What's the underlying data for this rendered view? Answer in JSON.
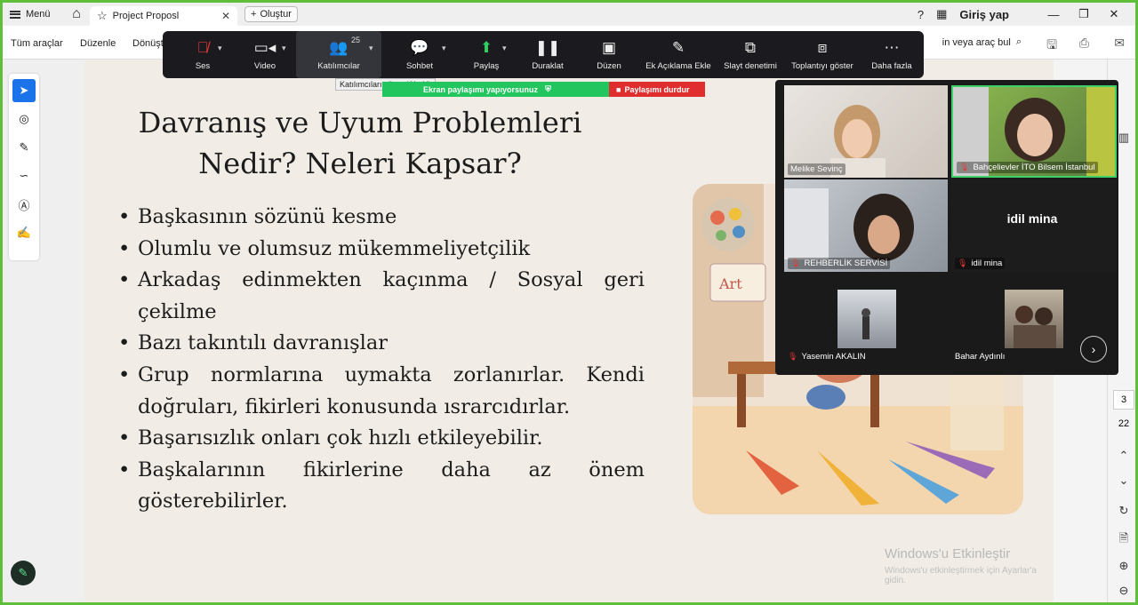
{
  "titlebar": {
    "menu_label": "Menü",
    "tab_title": "Project Proposl",
    "new_label": "Oluştur",
    "login_label": "Giriş yap"
  },
  "toolbar": {
    "items": [
      "Tüm araçlar",
      "Düzenle",
      "Dönüşt"
    ],
    "search_placeholder": "in veya araç bul"
  },
  "zoom_toolbar": {
    "buttons": [
      {
        "label": "Ses",
        "icon": "microphone-muted-icon"
      },
      {
        "label": "Video",
        "icon": "video-camera-icon"
      },
      {
        "label": "Katılımcılar",
        "icon": "participants-icon",
        "count": "25"
      },
      {
        "label": "Sohbet",
        "icon": "chat-icon"
      },
      {
        "label": "Paylaş",
        "icon": "share-screen-icon"
      },
      {
        "label": "Duraklat",
        "icon": "pause-icon"
      },
      {
        "label": "Düzen",
        "icon": "layout-icon"
      },
      {
        "label": "Ek Açıklama Ekle",
        "icon": "annotate-icon"
      },
      {
        "label": "Slayt denetimi",
        "icon": "slide-control-icon"
      },
      {
        "label": "Toplantıyı göster",
        "icon": "show-meeting-icon"
      },
      {
        "label": "Daha fazla",
        "icon": "more-icon"
      }
    ],
    "tooltip": "Katılımcıları yönet (Alt+U)",
    "share_status": "Ekran paylaşımı yapıyorsunuz",
    "stop_share": "Paylaşımı durdur"
  },
  "participants": [
    {
      "name": "Melike Sevinç",
      "muted": false
    },
    {
      "name": "Bahçelievler İTO Bilsem İstanbul",
      "muted": true
    },
    {
      "name": "REHBERLİK SERVİSİ",
      "muted": true
    },
    {
      "name": "idil mina",
      "muted": true,
      "video_off": true
    },
    {
      "name": "Yasemin AKALIN",
      "muted": true
    },
    {
      "name": "Bahar Aydınlı",
      "muted": false
    }
  ],
  "slide": {
    "title_line1": "Davranış ve Uyum Problemleri",
    "title_line2": "Nedir? Neleri Kapsar?",
    "bullets": [
      "Başkasının sözünü kesme",
      "Olumlu ve olumsuz mükemmeliyetçilik",
      "Arkadaş edinmekten kaçınma / Sosyal geri çekilme",
      "Bazı takıntılı davranışlar",
      "Grup normlarına uymakta zorlanırlar. Kendi doğruları, fikirleri konusunda ısrarcıdırlar.",
      "Başarısızlık onları çok hızlı etkileyebilir.",
      "Başkalarının fikirlerine daha az önem gösterebilirler."
    ]
  },
  "page_nav": {
    "current": "3",
    "total": "22"
  },
  "windows_watermark": {
    "line1": "Windows'u Etkinleştir",
    "line2": "Windows'u etkinleştirmek için Ayarlar'a gidin."
  }
}
